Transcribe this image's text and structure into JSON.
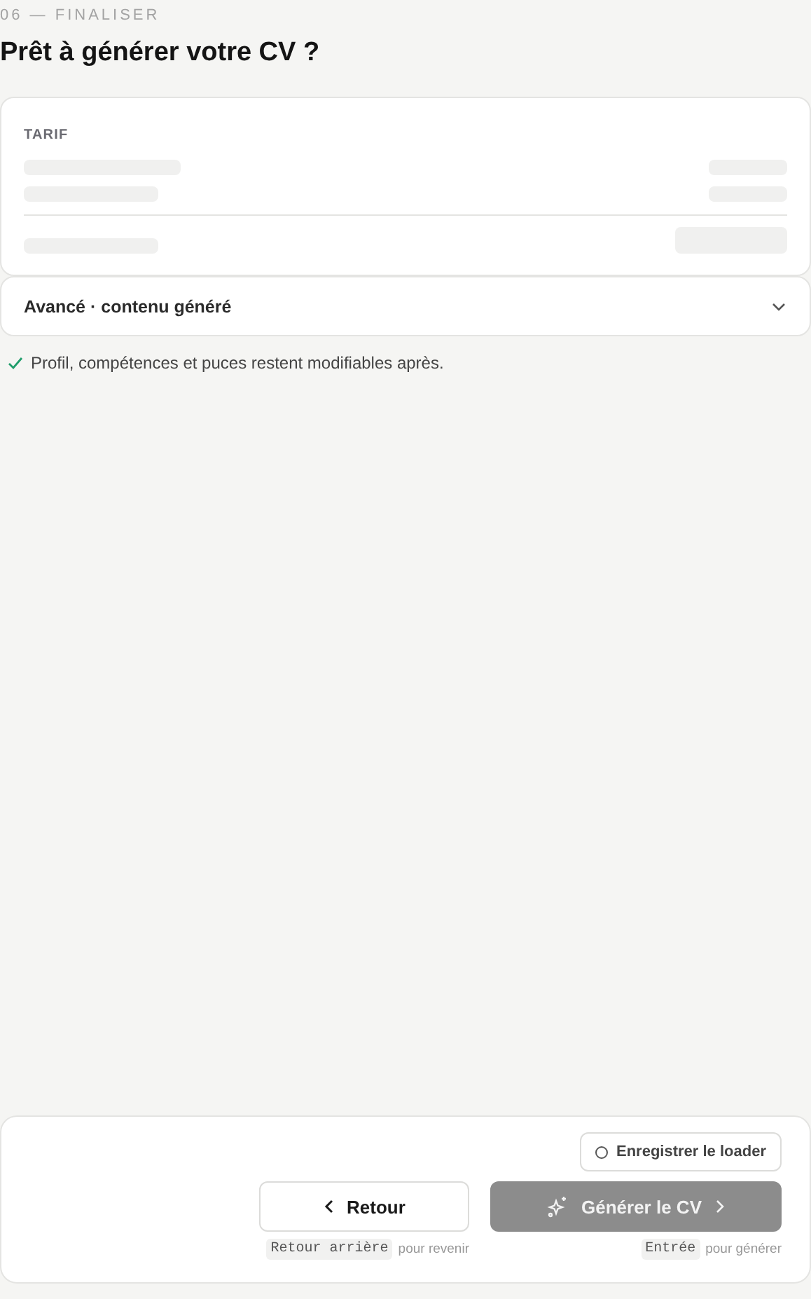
{
  "step": {
    "label": "06 — FINALISER",
    "title": "Prêt à générer votre CV ?"
  },
  "pricing": {
    "title": "TARIF",
    "loading": true
  },
  "advanced": {
    "label": "Avancé · contenu généré",
    "expanded": false
  },
  "note": {
    "text": "Profil, compétences et puces restent modifiables après."
  },
  "footer": {
    "record_loader": {
      "label": "Enregistrer le loader",
      "checked": false
    },
    "buttons": [
      {
        "kind": "back",
        "label": "Retour",
        "disabled": false,
        "shortcut": "Retour arrière",
        "hint": "pour revenir"
      },
      {
        "kind": "generate",
        "label": "Générer le CV",
        "disabled": true,
        "shortcut": "Entrée",
        "hint": "pour générer"
      }
    ]
  }
}
